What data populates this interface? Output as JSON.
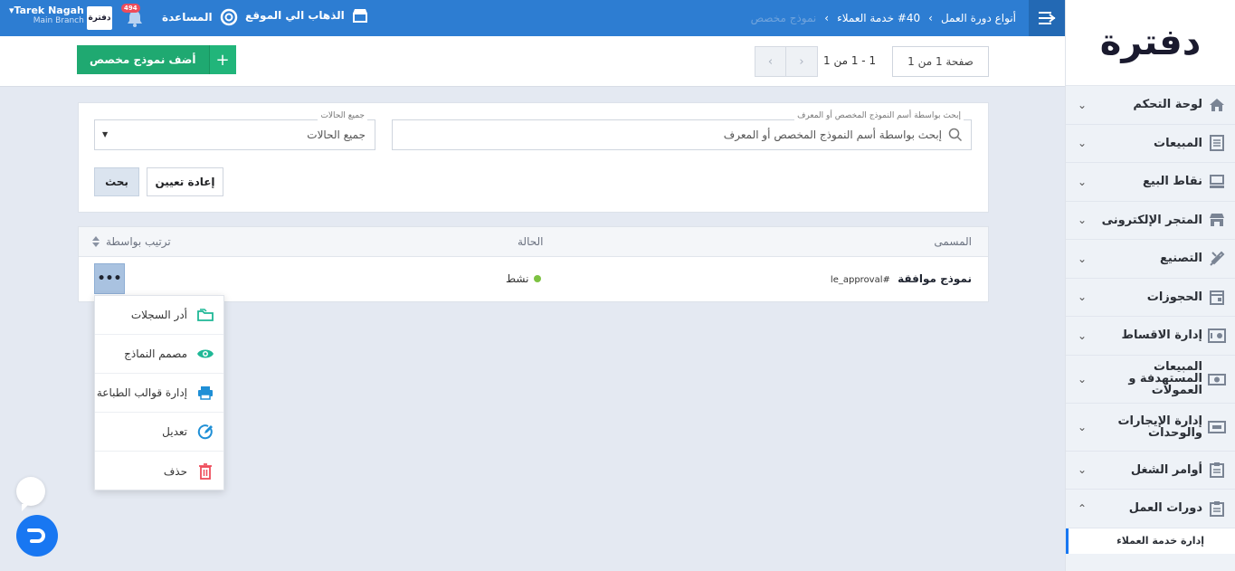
{
  "sidebar": {
    "logo_text_main": "دفترة",
    "items": [
      {
        "label": "لوحة التحكم",
        "icon": "home-icon"
      },
      {
        "label": "المبيعات",
        "icon": "receipt-icon"
      },
      {
        "label": "نقاط البيع",
        "icon": "pos-icon"
      },
      {
        "label": "المتجر الإلكترونى",
        "icon": "store-icon"
      },
      {
        "label": "التصنيع",
        "icon": "tools-icon"
      },
      {
        "label": "الحجوزات",
        "icon": "calendar-icon"
      },
      {
        "label": "إدارة الاقساط",
        "icon": "installments-icon"
      },
      {
        "label": "المبيعات المستهدفة و العمولات",
        "icon": "commission-icon"
      },
      {
        "label": "إدارة الإيجارات والوحدات",
        "icon": "rentals-icon"
      },
      {
        "label": "أوامر الشغل",
        "icon": "clipboard-icon"
      },
      {
        "label": "دورات العمل",
        "icon": "clipboard-icon"
      }
    ],
    "subitem": "إدارة خدمة العملاء"
  },
  "topbar": {
    "breadcrumb": [
      "أنواع دورة العمل",
      "#40 خدمة العملاء",
      "نموذج مخصص"
    ],
    "goto_site": "الذهاب الي الموقع",
    "help": "المساعدة",
    "notif_count": "494",
    "brand_mini": "دفترة",
    "user_name": "Tarek Nagah",
    "user_branch": "Main Branch"
  },
  "actionbar": {
    "add_label": "أضف نموذج مخصص",
    "page_label": "صفحة 1 من 1",
    "count_label": "1 - 1 من 1"
  },
  "search": {
    "search_label": "إبحث بواسطة أسم النموذج المخصص أو المعرف",
    "search_placeholder": "إبحث بواسطة أسم النموذج المخصص أو المعرف",
    "status_label": "جميع الحالات",
    "status_value": "جميع الحالات",
    "search_btn": "بحث",
    "reset_btn": "إعادة تعيين"
  },
  "table": {
    "col_title": "المسمى",
    "col_status": "الحالة",
    "sort_label": "ترتيب بواسطة",
    "rows": [
      {
        "name": "نموذج موافقة",
        "code": "#le_approval",
        "status": "نشط"
      }
    ]
  },
  "dropdown": [
    {
      "label": "أدر السجلات",
      "icon": "folders-icon",
      "color": "#1fb896"
    },
    {
      "label": "مصمم النماذج",
      "icon": "eye-icon",
      "color": "#1fb896"
    },
    {
      "label": "إدارة قوالب الطباعة",
      "icon": "printer-icon",
      "color": "#1f8fd6"
    },
    {
      "label": "تعديل",
      "icon": "edit-icon",
      "color": "#1f8fd6"
    },
    {
      "label": "حذف",
      "icon": "trash-icon",
      "color": "#ef4c5b"
    }
  ],
  "colors": {
    "topbar": "#2d7dd2",
    "add_button": "#1fa971",
    "status_active": "#7dc242",
    "accent": "#1877f2"
  }
}
